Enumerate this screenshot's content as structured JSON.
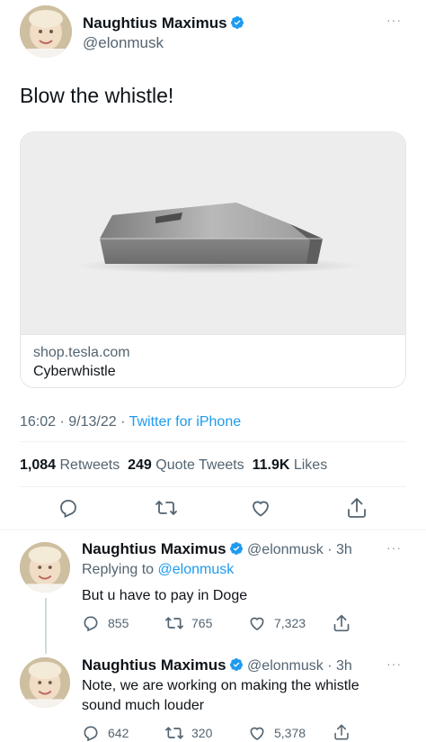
{
  "main_tweet": {
    "author_name": "Naughtius Maximus",
    "author_handle": "@elonmusk",
    "text": "Blow the whistle!",
    "card": {
      "domain": "shop.tesla.com",
      "title": "Cyberwhistle"
    },
    "meta": {
      "time": "16:02",
      "sep1": "·",
      "date": "9/13/22",
      "sep2": "·",
      "source": "Twitter for iPhone"
    },
    "stats": {
      "retweets_count": "1,084",
      "retweets_label": "Retweets",
      "quotes_count": "249",
      "quotes_label": "Quote Tweets",
      "likes_count": "11.9K",
      "likes_label": "Likes"
    },
    "more": "···"
  },
  "replies": [
    {
      "author_name": "Naughtius Maximus",
      "author_handle": "@elonmusk",
      "time": "· 3h",
      "replying_prefix": "Replying to",
      "replying_handle": "@elonmusk",
      "text": "But u have to pay in Doge",
      "replies_count": "855",
      "retweets_count": "765",
      "likes_count": "7,323",
      "more": "···"
    },
    {
      "author_name": "Naughtius Maximus",
      "author_handle": "@elonmusk",
      "time": "· 3h",
      "text_line1": "Note, we are working on making the whistle",
      "text_line2": "sound much louder",
      "replies_count": "642",
      "retweets_count": "320",
      "likes_count": "5,378",
      "more": "···"
    }
  ],
  "colors": {
    "accent": "#1d9bf0",
    "secondary_text": "#536471",
    "primary_text": "#0f1419"
  },
  "icons": {
    "verified": "verified-badge-icon",
    "reply": "reply-icon",
    "retweet": "retweet-icon",
    "like": "heart-icon",
    "share": "share-icon",
    "more": "more-icon"
  }
}
